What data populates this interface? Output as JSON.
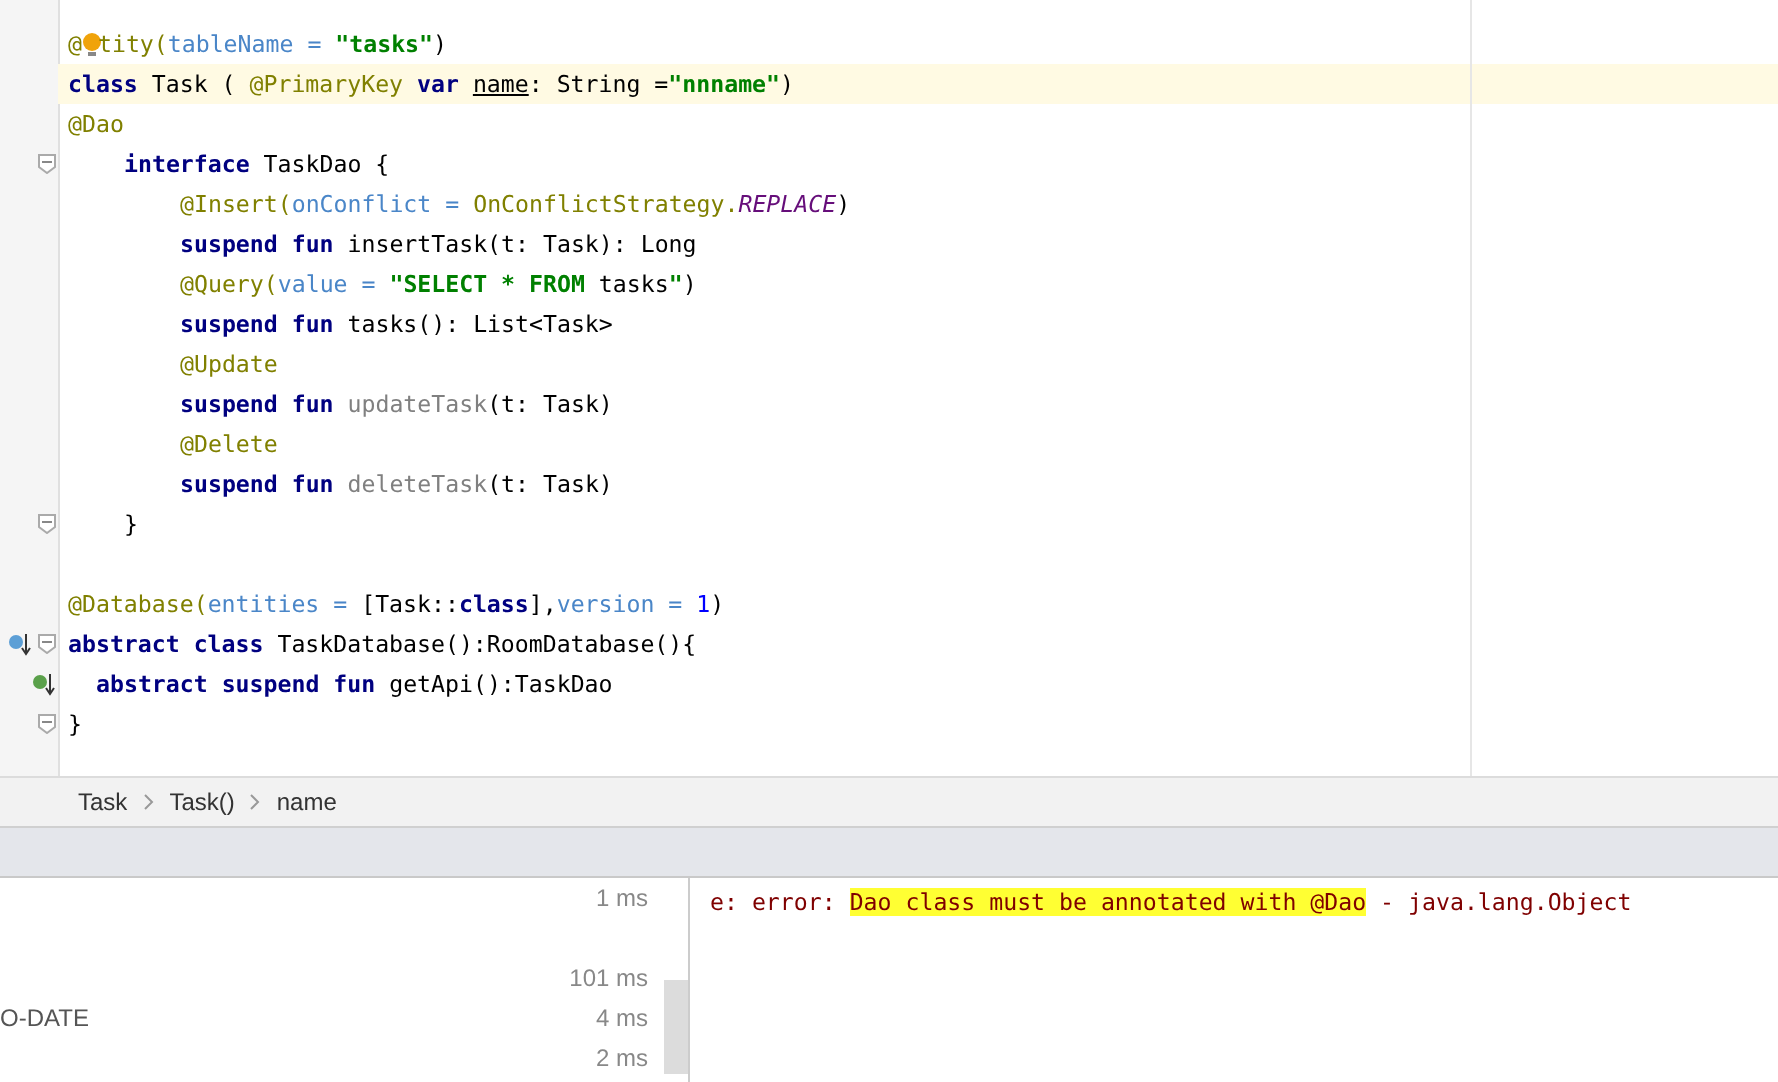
{
  "editor": {
    "lines": [
      {
        "kind": "top",
        "highlighted": false,
        "tokens": [
          {
            "kind": "annotation",
            "text": "@"
          },
          {
            "kind": "bulb"
          },
          {
            "kind": "annotation",
            "text": "tity("
          },
          {
            "kind": "param",
            "text": "tableName = "
          },
          {
            "kind": "string",
            "text": "\"tasks\""
          },
          {
            "kind": "plain",
            "text": ")"
          }
        ]
      },
      {
        "kind": "top",
        "highlighted": true,
        "tokens": [
          {
            "kind": "keyword",
            "text": "class"
          },
          {
            "kind": "plain",
            "text": " Task ( "
          },
          {
            "kind": "annotation",
            "text": "@PrimaryKey "
          },
          {
            "kind": "keyword",
            "text": "var "
          },
          {
            "kind": "property",
            "text": "name"
          },
          {
            "kind": "plain",
            "text": ": String ="
          },
          {
            "kind": "string",
            "text": "\"nnname\""
          },
          {
            "kind": "plain",
            "text": ")"
          }
        ]
      },
      {
        "kind": "top",
        "highlighted": false,
        "tokens": [
          {
            "kind": "annotation",
            "text": "@Dao"
          }
        ]
      },
      {
        "kind": "interface",
        "fold": true,
        "highlighted": false,
        "tokens": [
          {
            "kind": "keyword",
            "text": "interface"
          },
          {
            "kind": "plain",
            "text": " TaskDao {"
          }
        ]
      },
      {
        "kind": "member",
        "highlighted": false,
        "tokens": [
          {
            "kind": "annotation",
            "text": "@Insert("
          },
          {
            "kind": "param",
            "text": "onConflict = "
          },
          {
            "kind": "annotation",
            "text": "OnConflictStrategy."
          },
          {
            "kind": "constant",
            "text": "REPLACE"
          },
          {
            "kind": "plain",
            "text": ")"
          }
        ]
      },
      {
        "kind": "member",
        "highlighted": false,
        "tokens": [
          {
            "kind": "keyword",
            "text": "suspend fun"
          },
          {
            "kind": "plain",
            "text": " insertTask(t: Task): Long"
          }
        ]
      },
      {
        "kind": "member",
        "highlighted": false,
        "tokens": [
          {
            "kind": "annotation",
            "text": "@Query("
          },
          {
            "kind": "param",
            "text": "value = "
          },
          {
            "kind": "string",
            "text": "\"SELECT * FROM "
          },
          {
            "kind": "plain",
            "text": "tasks"
          },
          {
            "kind": "string",
            "text": "\""
          },
          {
            "kind": "plain",
            "text": ")"
          }
        ]
      },
      {
        "kind": "member",
        "highlighted": false,
        "tokens": [
          {
            "kind": "keyword",
            "text": "suspend fun"
          },
          {
            "kind": "plain",
            "text": " tasks(): List<Task>"
          }
        ]
      },
      {
        "kind": "member",
        "highlighted": false,
        "tokens": [
          {
            "kind": "annotation",
            "text": "@Update"
          }
        ]
      },
      {
        "kind": "member",
        "highlighted": false,
        "tokens": [
          {
            "kind": "keyword",
            "text": "suspend fun "
          },
          {
            "kind": "unused",
            "text": "updateTask"
          },
          {
            "kind": "plain",
            "text": "(t: Task)"
          }
        ]
      },
      {
        "kind": "member",
        "highlighted": false,
        "tokens": [
          {
            "kind": "annotation",
            "text": "@Delete"
          }
        ]
      },
      {
        "kind": "member",
        "highlighted": false,
        "tokens": [
          {
            "kind": "keyword",
            "text": "suspend fun "
          },
          {
            "kind": "unused",
            "text": "deleteTask"
          },
          {
            "kind": "plain",
            "text": "(t: Task)"
          }
        ]
      },
      {
        "kind": "interface",
        "fold": true,
        "highlighted": false,
        "tokens": [
          {
            "kind": "plain",
            "text": "}"
          }
        ]
      },
      {
        "kind": "top",
        "highlighted": false
      },
      {
        "kind": "top",
        "highlighted": false,
        "tokens": [
          {
            "kind": "annotation",
            "text": "@Database("
          },
          {
            "kind": "param",
            "text": "entities = "
          },
          {
            "kind": "plain",
            "text": "[Task::"
          },
          {
            "kind": "keyword",
            "text": "class"
          },
          {
            "kind": "plain",
            "text": "],"
          },
          {
            "kind": "param",
            "text": "version = "
          },
          {
            "kind": "number",
            "text": "1"
          },
          {
            "kind": "plain",
            "text": ")"
          }
        ]
      },
      {
        "kind": "top",
        "fold": true,
        "gutter_icon": {
          "kind": "overridden"
        },
        "highlighted": false,
        "tokens": [
          {
            "kind": "keyword",
            "text": "abstract class"
          },
          {
            "kind": "plain",
            "text": " TaskDatabase():RoomDatabase(){"
          }
        ]
      },
      {
        "kind": "inner",
        "gutter_icon": {
          "kind": "implemented"
        },
        "highlighted": false,
        "tokens": [
          {
            "kind": "keyword",
            "text": "abstract suspend fun"
          },
          {
            "kind": "plain",
            "text": " getApi():TaskDao"
          }
        ]
      },
      {
        "kind": "top",
        "fold": true,
        "highlighted": false,
        "tokens": [
          {
            "kind": "plain",
            "text": "}"
          }
        ]
      }
    ]
  },
  "breadcrumbs": [
    "Task",
    "Task()",
    "name"
  ],
  "build_list": {
    "rows": [
      {
        "time": "1 ms"
      },
      {},
      {
        "time": "101 ms"
      },
      {
        "label": "O-DATE",
        "time": "4 ms"
      },
      {
        "time": "2 ms"
      }
    ]
  },
  "console": {
    "prefix": "e: error: ",
    "highlighted": "Dao class must be annotated with @Dao",
    "suffix": " - java.lang.Object"
  }
}
